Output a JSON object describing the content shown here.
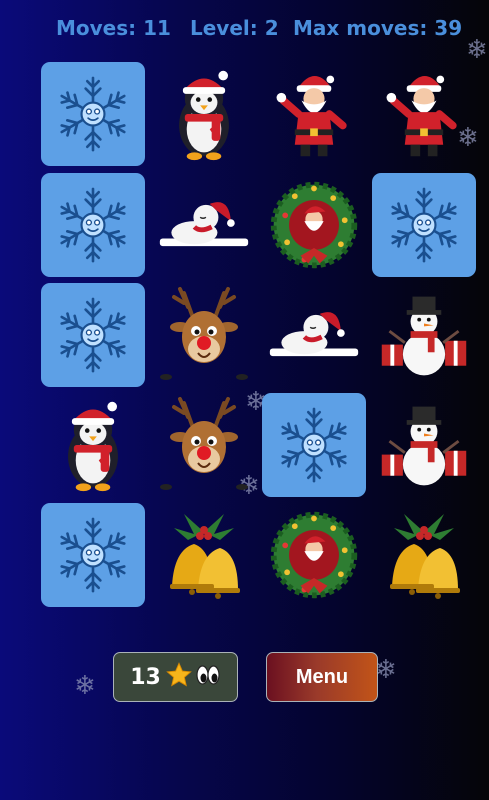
{
  "header": {
    "moves_label": "Moves: 11",
    "level_label": "Level: 2",
    "max_moves_label": "Max moves: 39"
  },
  "board": {
    "rows": [
      [
        "card-back",
        "penguin",
        "santa",
        "santa"
      ],
      [
        "card-back",
        "sleeping-snowman",
        "santa-wreath",
        "card-back"
      ],
      [
        "card-back",
        "reindeer",
        "sleeping-snowman",
        "snowman-gifts"
      ],
      [
        "penguin",
        "reindeer",
        "card-back",
        "snowman-gifts"
      ],
      [
        "card-back",
        "jingle-bells",
        "santa-wreath",
        "jingle-bells"
      ]
    ]
  },
  "footer": {
    "stars_count": "13",
    "star_icon": "star-icon",
    "eyes_icon": "eyes-icon",
    "menu_label": "Menu"
  },
  "colors": {
    "stats_text": "#4a8fdc",
    "card_back": "#5da0e6",
    "menu_button_gradient": [
      "#6b1020",
      "#c25418"
    ],
    "stars_button": "#3a473a"
  }
}
